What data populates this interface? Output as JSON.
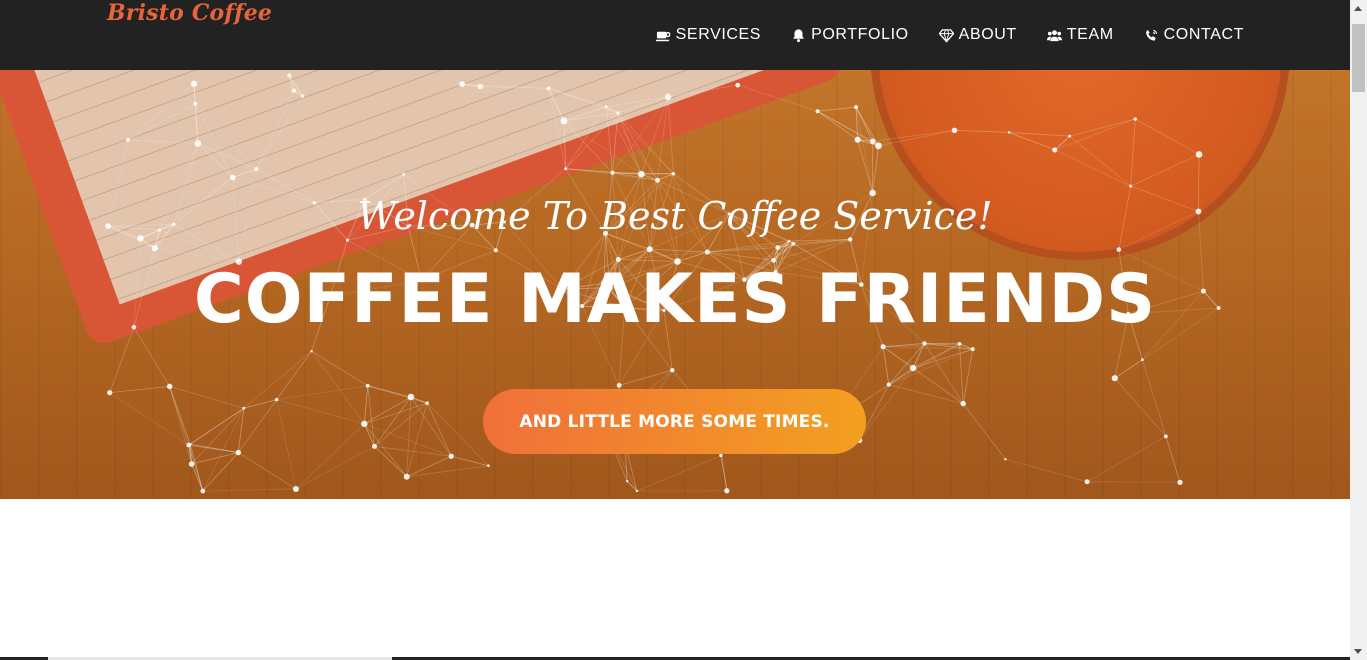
{
  "brand": {
    "name": "Bristo Coffee",
    "color": "#e8643a"
  },
  "nav": {
    "items": [
      {
        "label": "SERVICES",
        "icon": "coffee-cup-icon"
      },
      {
        "label": "PORTFOLIO",
        "icon": "bell-icon"
      },
      {
        "label": "ABOUT",
        "icon": "diamond-icon"
      },
      {
        "label": "TEAM",
        "icon": "users-icon"
      },
      {
        "label": "CONTACT",
        "icon": "phone-volume-icon"
      }
    ]
  },
  "hero": {
    "subtitle": "Welcome To Best Coffee Service!",
    "title": "COFFEE MAKES FRIENDS",
    "button_label": "AND LITTLE MORE SOME TIMES.",
    "button_gradient": [
      "#f0703a",
      "#f3a020"
    ]
  },
  "colors": {
    "navbar": "#222222",
    "text": "#ffffff"
  }
}
